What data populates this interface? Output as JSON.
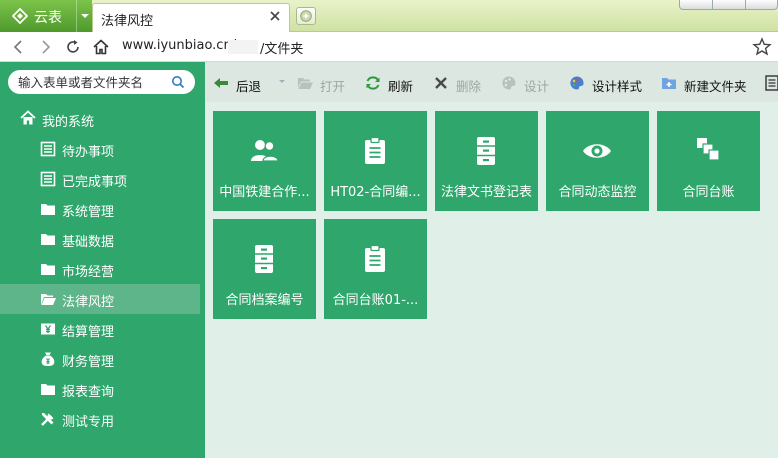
{
  "browser": {
    "brand": "云表",
    "active_tab": "法律风控",
    "url_host": "www.iyunbiao.cn/",
    "url_path": "/文件夹"
  },
  "sidebar": {
    "search_placeholder": "输入表单或者文件夹名",
    "root": {
      "label": "我的系统",
      "icon": "home-icon"
    },
    "items": [
      {
        "label": "待办事项",
        "icon": "list-icon"
      },
      {
        "label": "已完成事项",
        "icon": "list-icon"
      },
      {
        "label": "系统管理",
        "icon": "folder-icon"
      },
      {
        "label": "基础数据",
        "icon": "folder-icon"
      },
      {
        "label": "市场经营",
        "icon": "folder-icon"
      },
      {
        "label": "法律风控",
        "icon": "folder-icon",
        "active": true
      },
      {
        "label": "结算管理",
        "icon": "yen-card-icon"
      },
      {
        "label": "财务管理",
        "icon": "money-bag-icon"
      },
      {
        "label": "报表查询",
        "icon": "folder-icon"
      },
      {
        "label": "测试专用",
        "icon": "tools-icon"
      }
    ]
  },
  "toolbar": {
    "back": "后退",
    "open": "打开",
    "refresh": "刷新",
    "delete": "删除",
    "design": "设计",
    "design_style": "设计样式",
    "new_folder": "新建文件夹"
  },
  "tiles": [
    {
      "label": "中国铁建合作...",
      "icon": "users-icon"
    },
    {
      "label": "HT02-合同编...",
      "icon": "clipboard-icon"
    },
    {
      "label": "法律文书登记表",
      "icon": "file-cabinet-icon"
    },
    {
      "label": "合同动态监控",
      "icon": "eye-icon"
    },
    {
      "label": "合同台账",
      "icon": "clone-icon"
    },
    {
      "label": "合同档案编号",
      "icon": "file-cabinet-icon"
    },
    {
      "label": "合同台账01-...",
      "icon": "clipboard-icon"
    }
  ],
  "colors": {
    "sidebar_bg": "#2fa66c",
    "tile_bg": "#2fa66c",
    "active_item_bg": "#5eb589",
    "content_bg": "#e1efe9",
    "toolbar_bg": "#dde7e2"
  }
}
